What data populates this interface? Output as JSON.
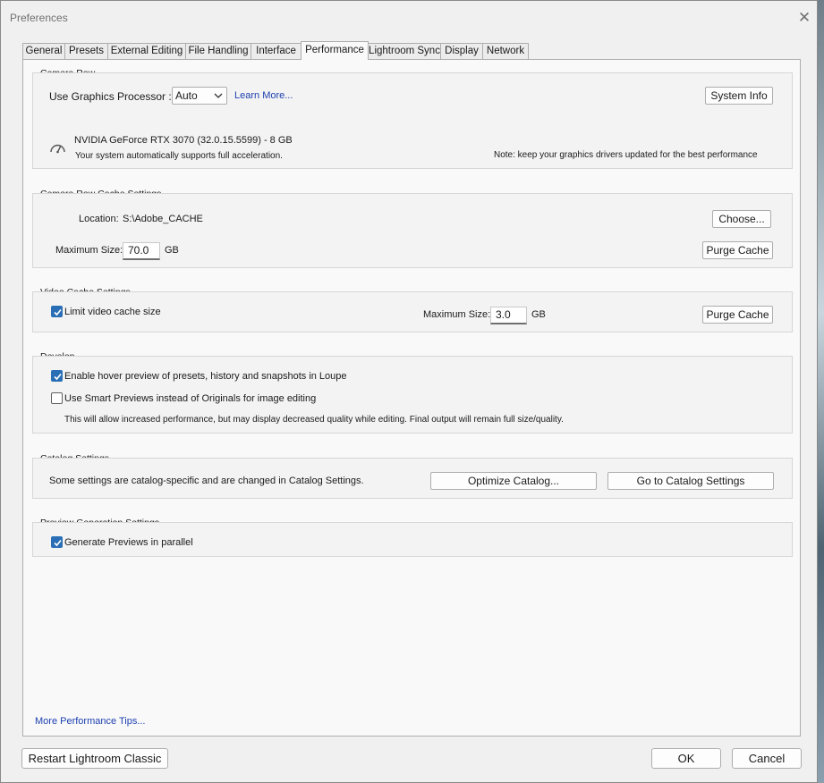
{
  "window": {
    "title": "Preferences"
  },
  "tabs": [
    {
      "label": "General",
      "active": false
    },
    {
      "label": "Presets",
      "active": false
    },
    {
      "label": "External Editing",
      "active": false
    },
    {
      "label": "File Handling",
      "active": false
    },
    {
      "label": "Interface",
      "active": false
    },
    {
      "label": "Performance",
      "active": true
    },
    {
      "label": "Lightroom Sync",
      "active": false
    },
    {
      "label": "Display",
      "active": false
    },
    {
      "label": "Network",
      "active": false
    }
  ],
  "camera_raw": {
    "title": "Camera Raw",
    "gpu_label": "Use Graphics Processor :",
    "gpu_value": "Auto",
    "learn_more": "Learn More...",
    "system_info": "System Info",
    "gpu_name": "NVIDIA GeForce RTX 3070 (32.0.15.5599) - 8 GB",
    "gpu_status": "Your system automatically supports full acceleration.",
    "note": "Note: keep your graphics drivers updated for the best performance"
  },
  "camera_raw_cache": {
    "title": "Camera Raw Cache Settings",
    "location_label": "Location:",
    "location_value": "S:\\Adobe_CACHE",
    "choose": "Choose...",
    "max_size_label": "Maximum Size:",
    "max_size_value": "70.0",
    "unit": "GB",
    "purge": "Purge Cache"
  },
  "video_cache": {
    "title": "Video Cache Settings",
    "limit_label": "Limit video cache size",
    "limit_checked": true,
    "max_size_label": "Maximum Size:",
    "max_size_value": "3.0",
    "unit": "GB",
    "purge": "Purge Cache"
  },
  "develop": {
    "title": "Develop",
    "hover_label": "Enable hover preview of presets, history and snapshots in Loupe",
    "hover_checked": true,
    "smart_label": "Use Smart Previews instead of Originals for image editing",
    "smart_checked": false,
    "smart_note": "This will allow increased performance, but may display decreased quality while editing. Final output will remain full size/quality."
  },
  "catalog": {
    "title": "Catalog Settings",
    "text": "Some settings are catalog-specific and are changed in Catalog Settings.",
    "optimize": "Optimize Catalog...",
    "goto": "Go to Catalog Settings"
  },
  "preview": {
    "title": "Preview Generation Settings",
    "parallel_label": "Generate Previews in parallel",
    "parallel_checked": true
  },
  "footer": {
    "tips_link": "More Performance Tips...",
    "restart": "Restart Lightroom Classic",
    "ok": "OK",
    "cancel": "Cancel"
  }
}
